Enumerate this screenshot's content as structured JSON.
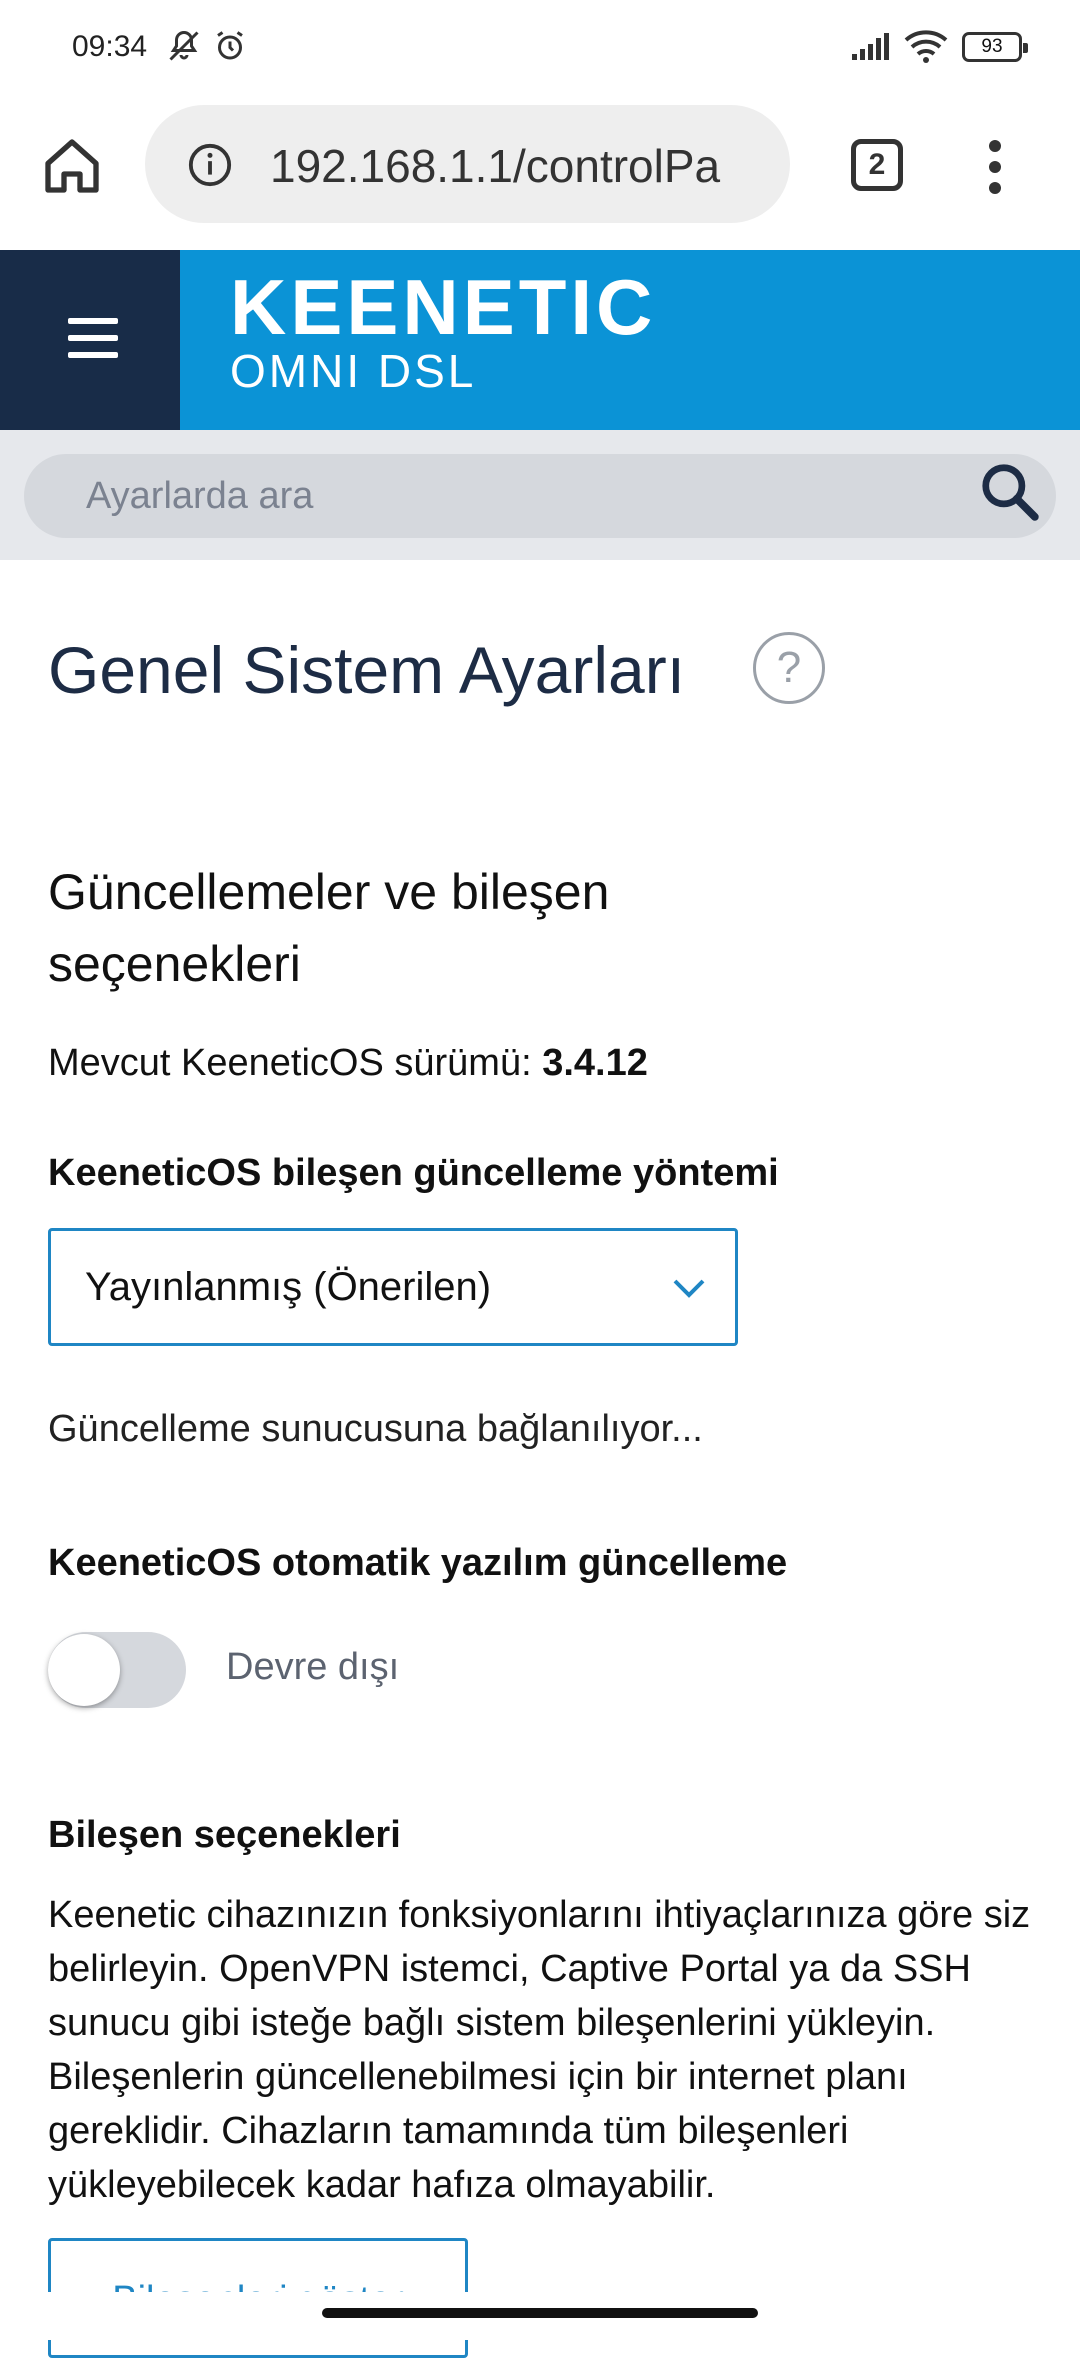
{
  "status_bar": {
    "time": "09:34",
    "battery": "93",
    "icons": [
      "mute-icon",
      "alarm-icon",
      "signal-icon",
      "wifi-icon",
      "battery-icon"
    ]
  },
  "browser": {
    "url": "192.168.1.1/controlPa",
    "tab_count": "2"
  },
  "header": {
    "brand": "KEENETIC",
    "model": "OMNI DSL",
    "colors": {
      "brand_bg": "#0b93d6",
      "menu_bg": "#182c48"
    }
  },
  "search": {
    "placeholder": "Ayarlarda ara"
  },
  "page": {
    "title": "Genel Sistem Ayarları",
    "help": "?",
    "section_title": "Güncellemeler ve bileşen seçenekleri",
    "version_label": "Mevcut KeeneticOS sürümü: ",
    "version_value": "3.4.12",
    "update_method_label": "KeeneticOS bileşen güncelleme yöntemi",
    "update_method_value": "Yayınlanmış (Önerilen)",
    "connecting_text": "Güncelleme sunucusuna bağlanılıyor...",
    "auto_update_label": "KeeneticOS otomatik yazılım güncelleme",
    "auto_update_state": "Devre dışı",
    "auto_update_enabled": false,
    "components_title": "Bileşen seçenekleri",
    "components_description": "Keenetic cihazınızın fonksiyonlarını ihtiyaçlarınıza göre siz belirleyin. OpenVPN istemci, Captive Portal ya da SSH sunucu gibi isteğe bağlı sistem bileşenlerini yükleyin. Bileşenlerin güncellenebilmesi için bir internet planı gereklidir. Cihazların tamamında tüm bileşenleri yükleyebilecek kadar hafıza olmayabilir.",
    "show_components_button": "Bileşenleri göster"
  }
}
